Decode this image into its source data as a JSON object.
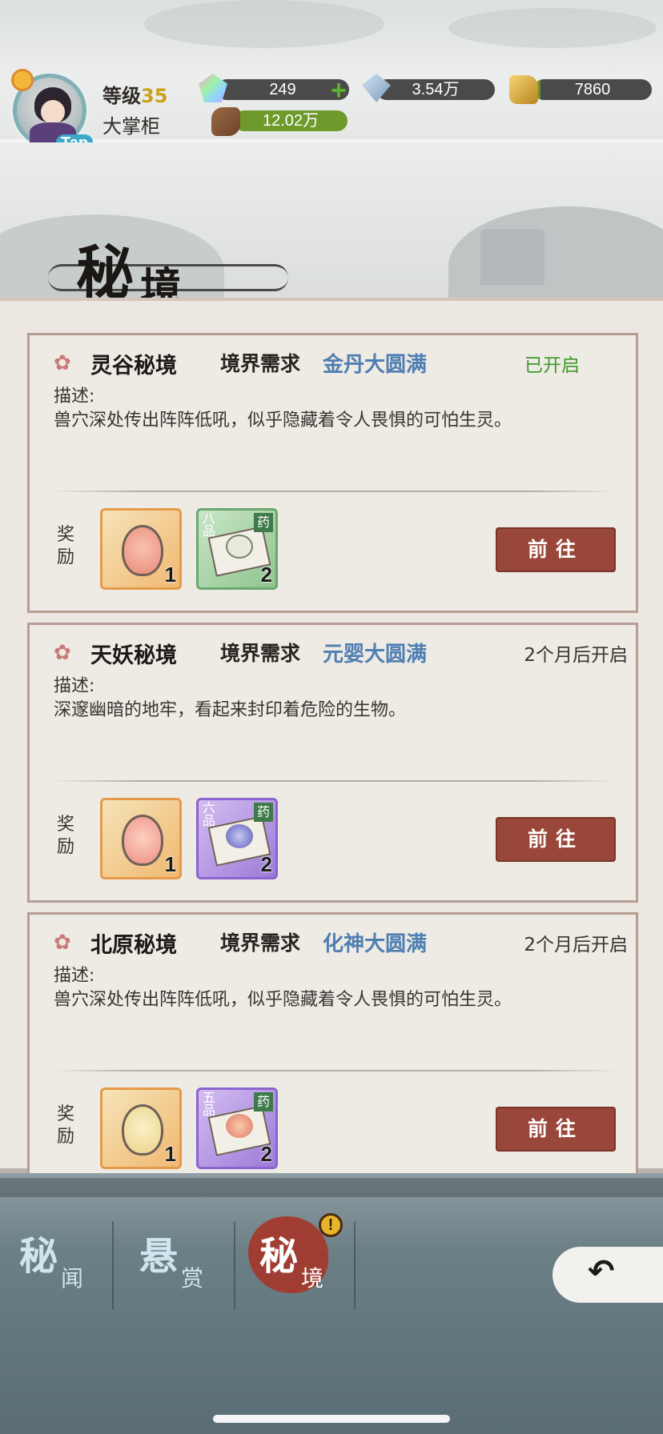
{
  "player": {
    "level_label": "等级",
    "level": "35",
    "rank": "大掌柜",
    "avatar_badge": "Tap"
  },
  "resources": [
    {
      "icon": "spirit-gem-icon",
      "value": "249",
      "has_plus": true
    },
    {
      "icon": "crystal-icon",
      "value": "3.54万"
    },
    {
      "icon": "gold-ingot-icon",
      "value": "7860"
    },
    {
      "icon": "wood-log-icon",
      "value": "12.02万"
    }
  ],
  "page_title": {
    "main": "秘",
    "second": "境"
  },
  "realms": [
    {
      "name": "灵谷秘境",
      "requirement_label": "境界需求",
      "requirement": "金丹大圆满",
      "status": "已开启",
      "status_color": "#3d9a2c",
      "desc_label": "描述:",
      "description": "兽穴深处传出阵阵低吼，似乎隐藏着令人畏惧的可怕生灵。",
      "reward_label": "奖励",
      "rewards": [
        {
          "icon": "spirit-egg-icon",
          "count": "1"
        },
        {
          "icon": "herb-icon",
          "grade": "八品",
          "tag": "药",
          "count": "2"
        }
      ],
      "button": "前往"
    },
    {
      "name": "天妖秘境",
      "requirement_label": "境界需求",
      "requirement": "元婴大圆满",
      "status": "2个月后开启",
      "desc_label": "描述:",
      "description": "深邃幽暗的地牢，看起来封印着危险的生物。",
      "reward_label": "奖励",
      "rewards": [
        {
          "icon": "spirit-egg-icon",
          "count": "1"
        },
        {
          "icon": "herb-icon",
          "grade": "六品",
          "tag": "药",
          "count": "2"
        }
      ],
      "button": "前往"
    },
    {
      "name": "北原秘境",
      "requirement_label": "境界需求",
      "requirement": "化神大圆满",
      "status": "2个月后开启",
      "desc_label": "描述:",
      "description": "兽穴深处传出阵阵低吼，似乎隐藏着令人畏惧的可怕生灵。",
      "reward_label": "奖励",
      "rewards": [
        {
          "icon": "spirit-egg-icon",
          "count": "1"
        },
        {
          "icon": "herb-icon",
          "grade": "五品",
          "tag": "药",
          "count": "2"
        }
      ],
      "button": "前往"
    }
  ],
  "nav": {
    "tabs": [
      {
        "big": "秘",
        "small": "闻"
      },
      {
        "big": "悬",
        "small": "赏"
      },
      {
        "big": "秘",
        "small": "境",
        "active": true,
        "alert": "!"
      }
    ],
    "back_icon": "back-arrow-icon"
  },
  "colors": {
    "accent_button": "#99473a",
    "requirement_text": "#4f7fb2",
    "open_status": "#3d9a2c"
  }
}
